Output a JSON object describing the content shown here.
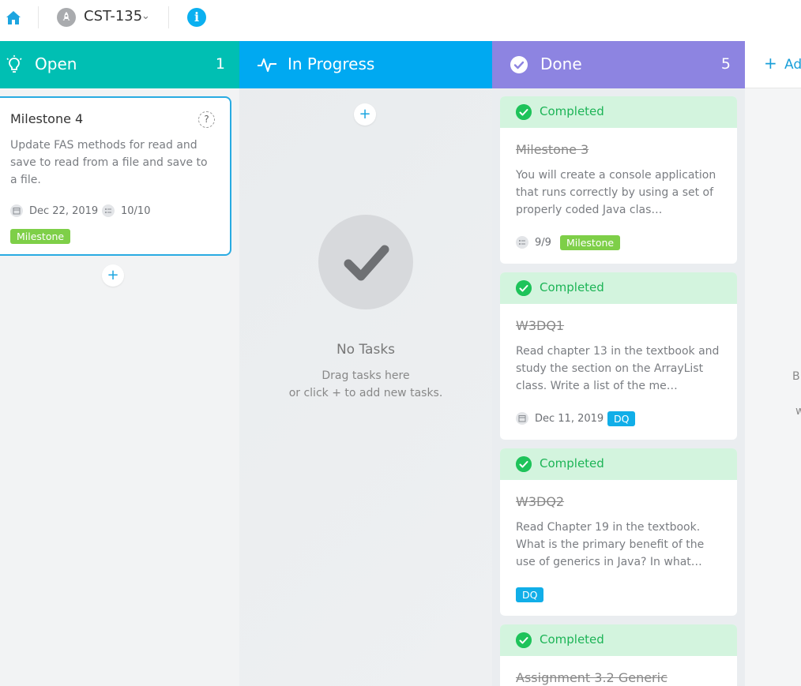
{
  "topbar": {
    "home_icon": "home-icon",
    "project_name": "CST-135",
    "project_icon": "rocket-icon",
    "info_icon": "info-icon",
    "info_glyph": "i"
  },
  "colors": {
    "open": "#00bfb3",
    "in_progress": "#00a9f1",
    "done": "#8d84e1",
    "completed_bg": "#d3f4de",
    "completed_text": "#1cb456",
    "milestone_tag": "#7ecf48",
    "dq_tag": "#11aee8"
  },
  "columns": {
    "open": {
      "title": "Open",
      "count": "1",
      "icon": "lightbulb-icon",
      "cards": [
        {
          "title": "Milestone 4",
          "description": "Update FAS methods for read and save to read from a file and save to a file.",
          "due_date": "Dec 22, 2019",
          "checklist": "10/10",
          "tag": "Milestone",
          "help": "?"
        }
      ],
      "add": "+"
    },
    "in_progress": {
      "title": "In Progress",
      "icon": "activity-icon",
      "add": "+",
      "empty_title": "No Tasks",
      "empty_line1": "Drag tasks here",
      "empty_line2": "or click + to add new tasks."
    },
    "done": {
      "title": "Done",
      "count": "5",
      "icon": "check-circle-icon",
      "cards": [
        {
          "status": "Completed",
          "title": "Milestone 3",
          "description": "You will create a console application that runs correctly by using a set of properly coded Java clas…",
          "checklist": "9/9",
          "tag": "Milestone"
        },
        {
          "status": "Completed",
          "title": "W3DQ1",
          "description": "Read chapter 13 in the textbook and study the section on the ArrayList class. Write a list of the me…",
          "due_date": "Dec 11, 2019",
          "tag": "DQ"
        },
        {
          "status": "Completed",
          "title": "W3DQ2",
          "description": "Read Chapter 19 in the textbook. What is the primary benefit of the use of generics in Java? In what…",
          "tag": "DQ"
        },
        {
          "status": "Completed",
          "title": "Assignment 3.2 Generic"
        }
      ]
    },
    "add_column": {
      "plus": "+",
      "label": "Ad",
      "edge_text_1": "B",
      "edge_text_2": "w"
    }
  }
}
